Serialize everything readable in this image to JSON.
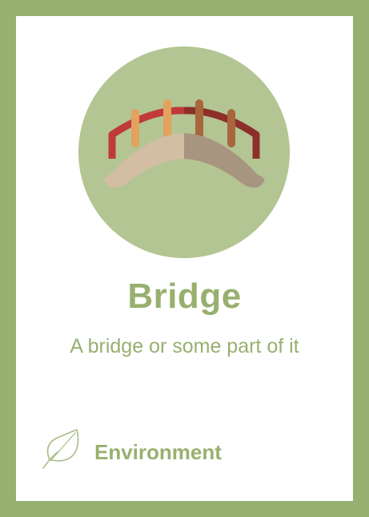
{
  "card": {
    "title": "Bridge",
    "description": "A bridge or some part of it",
    "category": {
      "label": "Environment",
      "icon": "leaf-icon"
    },
    "emblem_icon": "bridge-icon"
  },
  "colors": {
    "frame": "#98b06f",
    "circle": "#b3c592",
    "railing_red": "#c0393b",
    "railing_dark": "#8c2f2a",
    "post_light": "#e3a25e",
    "post_dark": "#a8663f",
    "deck_light": "#d3bea3",
    "deck_dark": "#a89580"
  }
}
